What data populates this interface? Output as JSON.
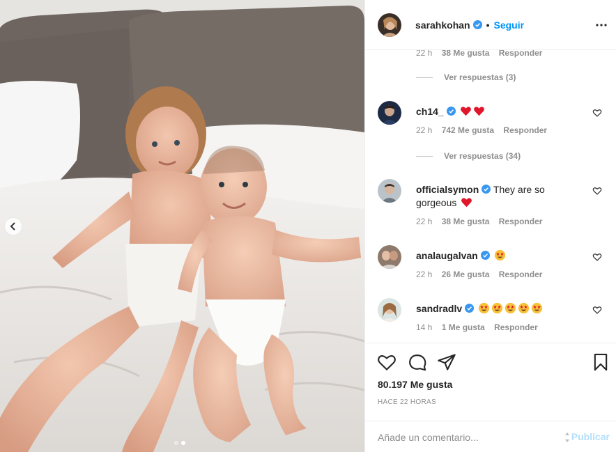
{
  "post": {
    "author": "sarahkohan",
    "bullet": "•",
    "follow_label": "Seguir",
    "likes": "80.197 Me gusta",
    "time_ago": "HACE 22 HORAS",
    "carousel": {
      "slides": 2,
      "active_index": 1
    }
  },
  "comments": {
    "top_partial": {
      "time": "22 h",
      "likes": "38 Me gusta",
      "reply": "Responder"
    },
    "view_replies_1": "Ver respuestas (3)",
    "items": [
      {
        "user": "ch14_",
        "text": "",
        "emojis": [
          "red-heart",
          "red-heart"
        ],
        "time": "22 h",
        "likes": "742 Me gusta",
        "reply": "Responder"
      },
      {
        "user": "officialsymon",
        "text": "They are so gorgeous",
        "emojis": [
          "red-heart"
        ],
        "time": "22 h",
        "likes": "38 Me gusta",
        "reply": "Responder"
      },
      {
        "user": "analaugalvan",
        "text": "",
        "emojis": [
          "star-struck"
        ],
        "time": "22 h",
        "likes": "26 Me gusta",
        "reply": "Responder"
      },
      {
        "user": "sandradlv",
        "text": "",
        "emojis": [
          "star-struck",
          "star-struck",
          "star-struck",
          "star-struck",
          "star-struck"
        ],
        "time": "14 h",
        "likes": "1 Me gusta",
        "reply": "Responder"
      }
    ],
    "view_replies_2": "Ver respuestas (34)"
  },
  "composer": {
    "placeholder": "Añade un comentario...",
    "publish_label": "Publicar"
  },
  "colors": {
    "link": "#0095f6",
    "verified": "#3897f0",
    "publish_disabled": "#b2dffc",
    "muted": "#8e8e8e"
  }
}
